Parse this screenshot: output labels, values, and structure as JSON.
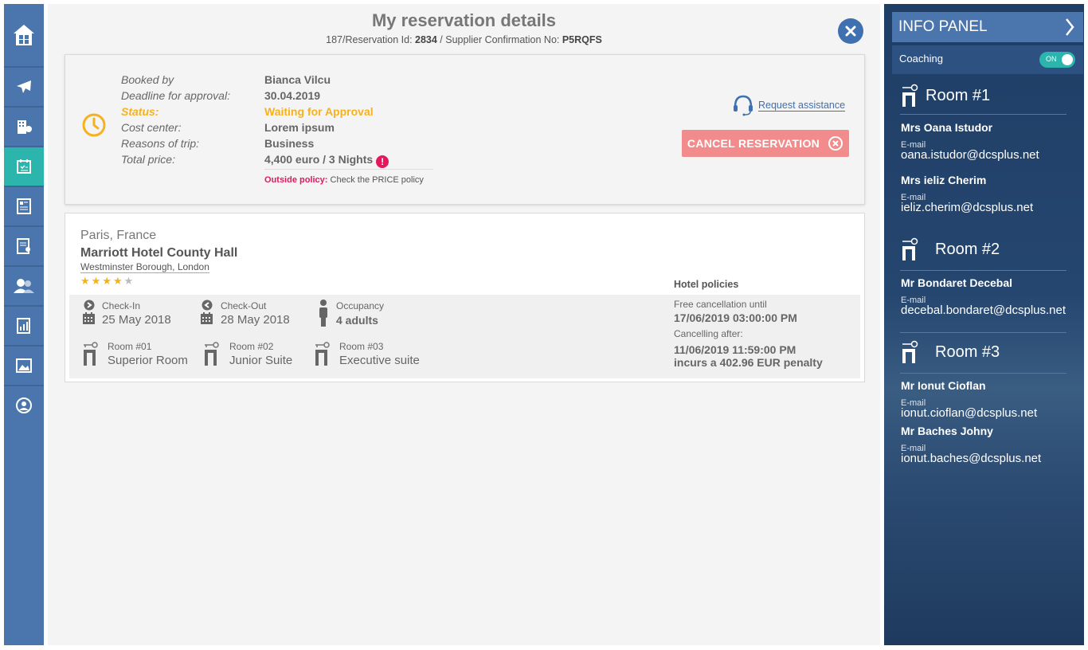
{
  "header": {
    "title": "My reservation details",
    "subtitle_prefix": "187/Reservation Id: ",
    "reservation_id": "2834",
    "subtitle_mid": " / Supplier Confirmation No: ",
    "confirmation_no": "P5RQFS"
  },
  "summary": {
    "labels": {
      "booked_by": "Booked by",
      "deadline": "Deadline for approval:",
      "status": "Status:",
      "cost_center": "Cost center:",
      "reasons": "Reasons of trip:",
      "total": "Total price:"
    },
    "values": {
      "booked_by": "Bianca Vilcu",
      "deadline": "30.04.2019",
      "status": "Waiting for Approval",
      "cost_center": "Lorem ipsum",
      "reasons": "Business",
      "total": "4,400 euro / 3 Nights"
    },
    "policy_label": "Outside policy:",
    "policy_text": "Check the PRICE policy",
    "assist_label": "Request assistance",
    "cancel_label": "CANCEL RESERVATION"
  },
  "hotel": {
    "city": "Paris, France",
    "name": "Marriott Hotel County Hall",
    "address": "Westminster Borough, London",
    "rating": 4,
    "rating_max": 5,
    "checkin_label": "Check-In",
    "checkin": "25 May 2018",
    "checkout_label": "Check-Out",
    "checkout": "28 May 2018",
    "occupancy_label": "Occupancy",
    "occupancy": "4 adults",
    "rooms": [
      {
        "label": "Room #01",
        "type": "Superior Room"
      },
      {
        "label": "Room #02",
        "type": "Junior Suite"
      },
      {
        "label": "Room #03",
        "type": "Executive suite"
      }
    ],
    "policies_title": "Hotel policies",
    "free_cancel_label": "Free cancellation until",
    "free_cancel_date": "17/06/2019 03:00:00 PM",
    "cancel_after_label": "Cancelling after:",
    "cancel_after_date": "11/06/2019 11:59:00 PM",
    "penalty": "incurs a 402.96 EUR penalty"
  },
  "info_panel": {
    "title": "INFO PANEL",
    "coaching_label": "Coaching",
    "toggle_label": "ON",
    "email_label": "E-mail",
    "rooms": [
      {
        "title": "Room #1",
        "guests": [
          {
            "name": "Mrs Oana Istudor",
            "email": "oana.istudor@dcsplus.net"
          },
          {
            "name": "Mrs ieliz Cherim",
            "email": "ieliz.cherim@dcsplus.net"
          }
        ]
      },
      {
        "title": "Room #2",
        "guests": [
          {
            "name": "Mr Bondaret Decebal",
            "email": "decebal.bondaret@dcsplus.net"
          }
        ]
      },
      {
        "title": "Room #3",
        "guests": [
          {
            "name": "Mr Ionut Cioflan",
            "email": "ionut.cioflan@dcsplus.net"
          },
          {
            "name": "Mr Baches Johny",
            "email": "ionut.baches@dcsplus.net"
          }
        ]
      }
    ]
  },
  "colors": {
    "nav": "#4a76ad",
    "active": "#2bb5ad",
    "status": "#f5b21e",
    "danger": "#e5175f",
    "cancel": "#f28b8b"
  }
}
